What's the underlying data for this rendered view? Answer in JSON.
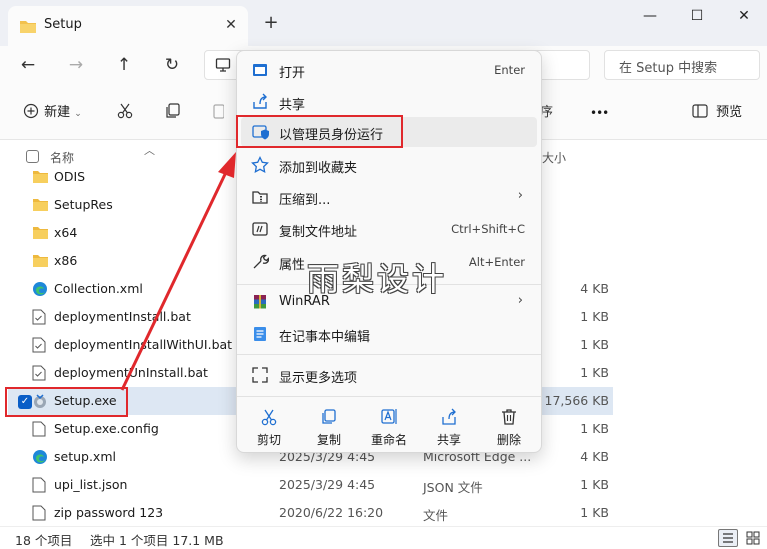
{
  "window": {
    "tab_title": "Setup",
    "tab_close": "✕",
    "new_tab": "+",
    "minimize": "—",
    "maximize": "☐",
    "close": "✕"
  },
  "nav": {
    "back": "←",
    "forward": "→",
    "up": "↑",
    "refresh": "↻",
    "search_placeholder": "在 Setup 中搜索"
  },
  "toolbar": {
    "new_label": "新建",
    "more": "•••",
    "preview_label": "预览",
    "sort_fragment": "序"
  },
  "columns": {
    "name": "名称",
    "size": "大小"
  },
  "files": [
    {
      "name": "ODIS",
      "kind": "folder",
      "date": "",
      "type": "",
      "size": ""
    },
    {
      "name": "SetupRes",
      "kind": "folder",
      "date": "",
      "type": "",
      "size": ""
    },
    {
      "name": "x64",
      "kind": "folder",
      "date": "",
      "type": "",
      "size": ""
    },
    {
      "name": "x86",
      "kind": "folder",
      "date": "",
      "type": "",
      "size": ""
    },
    {
      "name": "Collection.xml",
      "kind": "edge",
      "date": "",
      "type": "",
      "size": "4 KB"
    },
    {
      "name": "deploymentInstall.bat",
      "kind": "bat",
      "date": "",
      "type": "",
      "size": "1 KB"
    },
    {
      "name": "deploymentInstallWithUI.bat",
      "kind": "bat",
      "date": "",
      "type": "",
      "size": "1 KB"
    },
    {
      "name": "deploymentUnInstall.bat",
      "kind": "bat",
      "date": "",
      "type": "",
      "size": "1 KB"
    },
    {
      "name": "Setup.exe",
      "kind": "exe",
      "date": "",
      "type": "",
      "size": "17,566 KB"
    },
    {
      "name": "Setup.exe.config",
      "kind": "file",
      "date": "",
      "type": "",
      "size": "1 KB"
    },
    {
      "name": "setup.xml",
      "kind": "edge",
      "date": "2025/3/29 4:45",
      "type": "Microsoft Edge ...",
      "size": "4 KB"
    },
    {
      "name": "upi_list.json",
      "kind": "file",
      "date": "2025/3/29 4:45",
      "type": "JSON 文件",
      "size": "1 KB"
    },
    {
      "name": "zip password 123",
      "kind": "file",
      "date": "2020/6/22 16:20",
      "type": "文件",
      "size": "1 KB"
    }
  ],
  "status": {
    "count": "18 个项目",
    "selection": "选中 1 个项目  17.1 MB"
  },
  "context_menu": {
    "items": [
      {
        "label": "打开",
        "shortcut": "Enter"
      },
      {
        "label": "共享",
        "shortcut": ""
      },
      {
        "label": "以管理员身份运行",
        "shortcut": ""
      },
      {
        "label": "添加到收藏夹",
        "shortcut": ""
      },
      {
        "label": "压缩到...",
        "shortcut": ""
      },
      {
        "label": "复制文件地址",
        "shortcut": "Ctrl+Shift+C"
      },
      {
        "label": "属性",
        "shortcut": "Alt+Enter"
      },
      {
        "label": "WinRAR",
        "shortcut": ""
      },
      {
        "label": "在记事本中编辑",
        "shortcut": ""
      },
      {
        "label": "显示更多选项",
        "shortcut": ""
      }
    ],
    "quick_actions": [
      {
        "label": "剪切"
      },
      {
        "label": "复制"
      },
      {
        "label": "重命名"
      },
      {
        "label": "共享"
      },
      {
        "label": "删除"
      }
    ]
  },
  "watermark": "雨梨设计",
  "colors": {
    "accent": "#0a5ec7",
    "highlight": "#e0282c",
    "selection": "#dde7f3"
  }
}
